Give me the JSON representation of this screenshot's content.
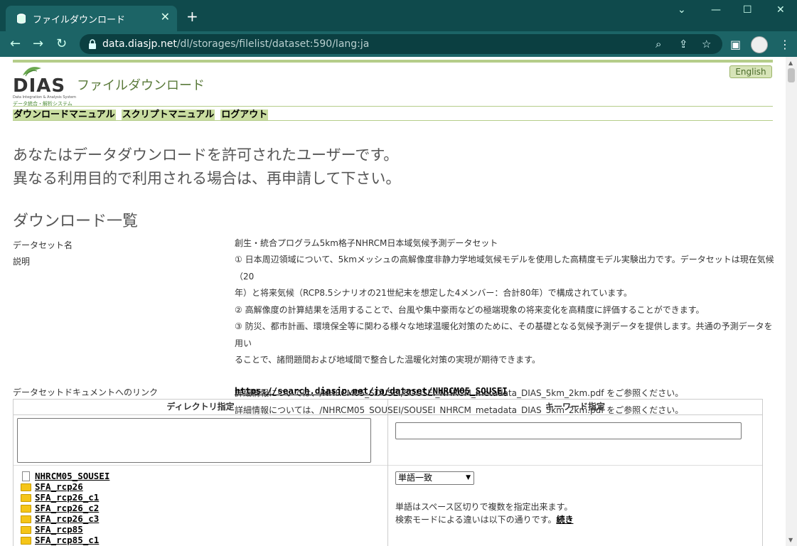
{
  "browser": {
    "tab_title": "ファイルダウンロード",
    "tab_close": "✕",
    "new_tab": "+",
    "url_host": "data.diasjp.net",
    "url_path": "/dl/storages/filelist/dataset:590/lang:ja",
    "win_min": "—",
    "win_max": "☐",
    "win_close": "✕",
    "win_dropdown": "⌄"
  },
  "header": {
    "logo_word": "DIAS",
    "logo_sub_en": "Data Integration & Analysis System",
    "logo_sub_ja": "データ統合・解析システム",
    "site_title": "ファイルダウンロード",
    "english_button": "English"
  },
  "menu": {
    "items": [
      "ダウンロードマニュアル",
      "スクリプトマニュアル",
      "ログアウト"
    ]
  },
  "main": {
    "message_line1": "あなたはデータダウンロードを許可されたユーザーです。",
    "message_line2": "異なる利用目的で利用される場合は、再申請して下さい。",
    "heading": "ダウンロード一覧",
    "dataset_label": "データセット名",
    "dataset_name": "創生・統合プログラム5km格子NHRCM日本域気候予測データセット",
    "desc_label": "説明",
    "desc_lines": [
      "① 日本周辺領域について、5kmメッシュの高解像度非静力学地域気候モデルを使用した高精度モデル実験出力です。データセットは現在気候（20",
      "年）と将来気候（RCP8.5シナリオの21世紀末を想定した4メンバー：合計80年）で構成されています。",
      "② 高解像度の計算結果を活用することで、台風や集中豪雨などの極端現象の将来変化を高精度に評価することができます。",
      "③ 防災、都市計画、環境保全等に関わる様々な地球温暖化対策のために、その基礎となる気候予測データを提供します。共通の予測データを用い",
      "ることで、諸問題間および地域間で整合した温暖化対策の実現が期待できます。",
      "",
      "詳細情報については、/NHRCM05_SOUSEI/SOUSEI_NHRCM_metadata_DIAS_5km_2km.pdf をご参照ください。",
      "詳細情報については、/NHRCM05_SOUSEI/SOUSEI_NHRCM_metadata_DIAS_5km_2km.pdf をご参照ください。"
    ],
    "doc_label": "データセットドキュメントへのリンク",
    "doc_link": "https://search.diasjp.net/ja/dataset/NHRCM05_SOUSEI"
  },
  "search": {
    "dir_header": "ディレクトリ指定",
    "kw_header": "キーワード指定",
    "tree": [
      {
        "type": "file",
        "name": "NHRCM05_SOUSEI"
      },
      {
        "type": "folder",
        "name": "SFA_rcp26"
      },
      {
        "type": "folder",
        "name": "SFA_rcp26_c1"
      },
      {
        "type": "folder",
        "name": "SFA_rcp26_c2"
      },
      {
        "type": "folder",
        "name": "SFA_rcp26_c3"
      },
      {
        "type": "folder",
        "name": "SFA_rcp85"
      },
      {
        "type": "folder",
        "name": "SFA_rcp85_c1"
      }
    ],
    "mode_selected": "単語一致",
    "help_line1": "単語はスペース区切りで複数を指定出来ます。",
    "help_line2": "検索モードによる違いは以下の通りです。",
    "help_more": "続き"
  }
}
